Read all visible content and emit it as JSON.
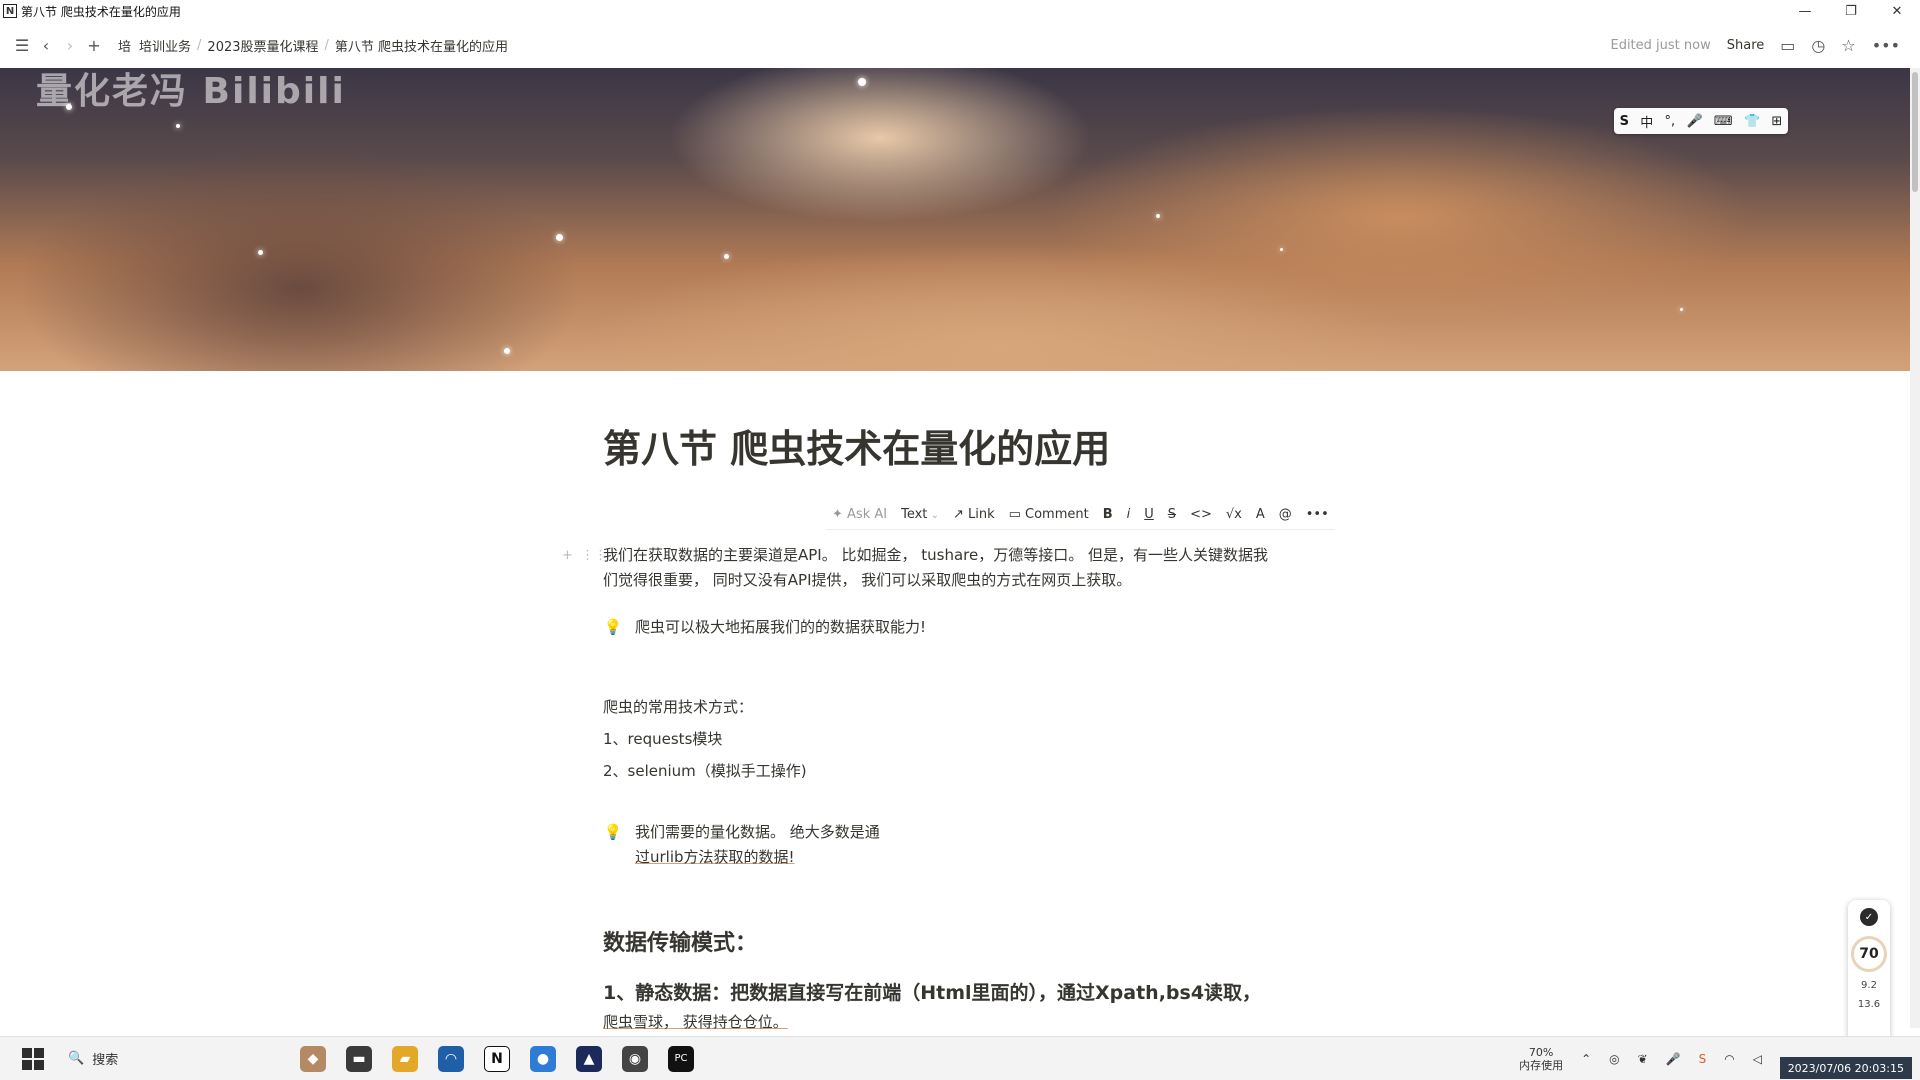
{
  "window": {
    "title": "第八节 爬虫技术在量化的应用",
    "app_icon_letter": "N",
    "minimize": "—",
    "maximize": "❐",
    "close": "✕"
  },
  "topbar": {
    "breadcrumbs": [
      "培",
      "培训业务",
      "2023股票量化课程",
      "第八节 爬虫技术在量化的应用"
    ],
    "edited": "Edited just now",
    "share": "Share"
  },
  "cover": {
    "watermark": "量化老冯 Bilibili"
  },
  "ime": {
    "items": [
      "S",
      "中",
      "°,",
      "🎤",
      "⌨",
      "👕",
      "⊞"
    ]
  },
  "page": {
    "title": "第八节 爬虫技术在量化的应用",
    "toolbar": {
      "ask_ai": "Ask AI",
      "text": "Text",
      "link": "Link",
      "comment": "Comment",
      "bold": "B",
      "italic": "i",
      "underline": "U",
      "strike": "S",
      "code": "<>",
      "math": "√x",
      "color": "A",
      "mention": "@",
      "more": "•••"
    },
    "intro_line1": "我们在获取数据的主要渠道是API。 比如掘金， tushare，万德等接口。 但是，有一些人关键数据我",
    "intro_line2": "们觉得很重要， 同时又没有API提供， 我们可以采取爬虫的方式在网页上获取。",
    "callout1": "爬虫可以极大地拓展我们的的数据获取能力!",
    "methods_title": "爬虫的常用技术方式：",
    "method1": "1、requests模块",
    "method2": "2、selenium（模拟手工操作)",
    "callout2_line1": "我们需要的量化数据。 绝大多数是通",
    "callout2_line2": "过urlib方法获取的数据!",
    "section_heading": "数据传输模式：",
    "static_heading": "1、静态数据：把数据直接写在前端（Html里面的），通过Xpath,bs4读取，",
    "static_sub": "爬虫雪球， 获得持仓仓位。"
  },
  "widget": {
    "score": "70",
    "up": "9.2",
    "down": "13.6"
  },
  "taskbar": {
    "search": "搜索",
    "memory_pct": "70%",
    "memory_label": "内存使用",
    "datetime": "2023/07/06 20:03:15"
  },
  "colors": {
    "text": "#37352f",
    "muted": "#9b9a97",
    "underline_accent": "#d7a07a",
    "clock_bg": "#2c3a4a"
  }
}
